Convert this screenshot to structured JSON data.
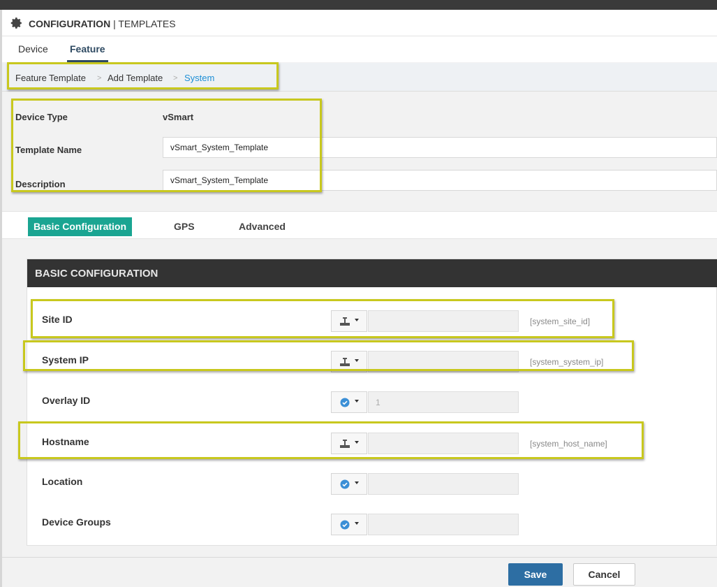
{
  "header": {
    "title_bold": "CONFIGURATION",
    "title_rest": " | TEMPLATES",
    "icon": "gear-icon"
  },
  "tabs": {
    "device": "Device",
    "feature": "Feature",
    "active": "Feature"
  },
  "breadcrumb": {
    "items": [
      "Feature Template",
      "Add Template",
      "System"
    ],
    "separator": ">"
  },
  "info": {
    "device_type_label": "Device Type",
    "device_type_value": "vSmart",
    "template_name_label": "Template Name",
    "template_name_value": "vSmart_System_Template",
    "description_label": "Description",
    "description_value": "vSmart_System_Template"
  },
  "subtabs": {
    "basic": "Basic Configuration",
    "gps": "GPS",
    "advanced": "Advanced",
    "active": "Basic Configuration"
  },
  "section": {
    "title": "BASIC CONFIGURATION",
    "rows": [
      {
        "label": "Site ID",
        "scope_icon": "device-specific-icon",
        "value": "",
        "hint": "[system_site_id]"
      },
      {
        "label": "System IP",
        "scope_icon": "device-specific-icon",
        "value": "",
        "hint": "[system_system_ip]"
      },
      {
        "label": "Overlay ID",
        "scope_icon": "default-check-icon",
        "value": "1",
        "hint": ""
      },
      {
        "label": "Hostname",
        "scope_icon": "device-specific-icon",
        "value": "",
        "hint": "[system_host_name]"
      },
      {
        "label": "Location",
        "scope_icon": "default-check-icon",
        "value": "",
        "hint": ""
      },
      {
        "label": "Device Groups",
        "scope_icon": "default-check-icon",
        "value": "",
        "hint": ""
      }
    ]
  },
  "footer": {
    "save": "Save",
    "cancel": "Cancel"
  },
  "colors": {
    "accent_teal": "#1aa592",
    "link_blue": "#1e8fd6",
    "save_blue": "#2d6ea3",
    "highlight": "#c8c81e",
    "check_blue": "#3b8fd6"
  }
}
